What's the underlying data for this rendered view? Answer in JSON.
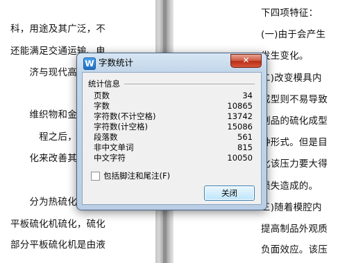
{
  "document": {
    "left_lines": [
      "科，用途及其广泛，不",
      "还能满足交通运输、电",
      "济与现代高科技领",
      "",
      "维织物和金属材料",
      "程之后，成为半",
      "化来改善其自身的",
      "分为热硫化，冷硫",
      "平板硫化机硫化，硫化",
      "部分平板硫化机是由液"
    ],
    "right_lines": [
      "下四项特征：",
      "(一)由于会产生",
      "发生变化。",
      "二)改变模具内",
      "成型则不易导致",
      "制品的硫化成型",
      "种形式。但是目",
      "化该压力要大得",
      "损失造成的。",
      "三)随着模腔内",
      "提高制品外观质",
      "负面效应。该压"
    ]
  },
  "dialog": {
    "title": "字数统计",
    "app_icon": "W",
    "close_glyph": "✕",
    "section_label": "统计信息",
    "stats": [
      {
        "label": "页数",
        "value": "34"
      },
      {
        "label": "字数",
        "value": "10865"
      },
      {
        "label": "字符数(不计空格)",
        "value": "13742"
      },
      {
        "label": "字符数(计空格)",
        "value": "15086"
      },
      {
        "label": "段落数",
        "value": "561"
      },
      {
        "label": "非中文单词",
        "value": "815"
      },
      {
        "label": "中文字符",
        "value": "10050"
      }
    ],
    "checkbox_label": "包括脚注和尾注(F)",
    "checkbox_checked": false,
    "close_button_label": "关闭"
  },
  "icons": {
    "app": "wps-writer-icon",
    "close": "close-icon"
  }
}
